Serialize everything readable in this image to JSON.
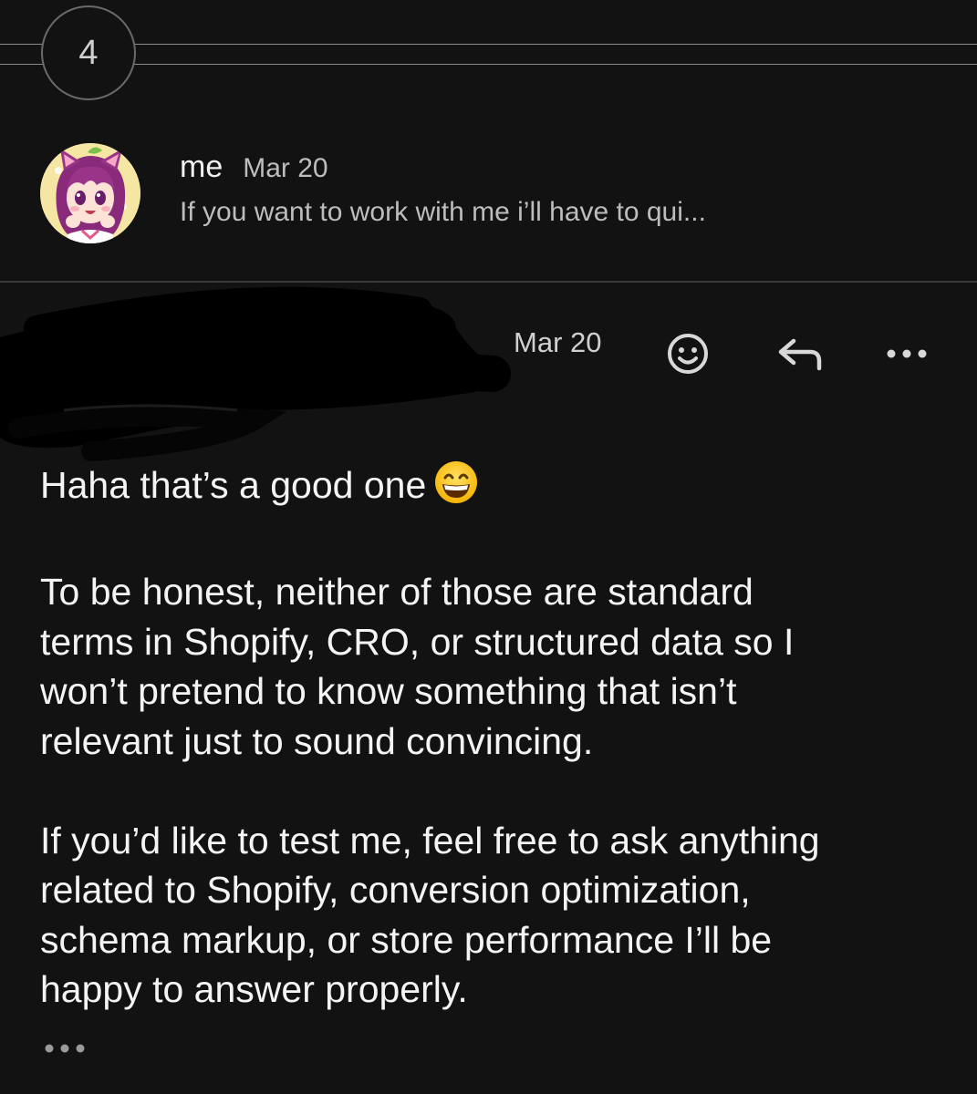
{
  "thread": {
    "collapsed_count": "4"
  },
  "collapsed_message": {
    "sender": "me",
    "date": "Mar 20",
    "snippet": "If you want to work with me i’ll have to qui..."
  },
  "expanded_message": {
    "date": "Mar 20",
    "body": {
      "line1": "Haha that’s a good one",
      "emoji": "grinning-face-emoji",
      "paragraph2": [
        "To be honest, neither of those are standard",
        "terms in Shopify, CRO, or structured data so I",
        "won’t pretend to know something that isn’t",
        "relevant just to sound convincing."
      ],
      "paragraph3": [
        "If you’d like to test me, feel free to ask anything",
        "related to Shopify, conversion optimization,",
        "schema markup, or store performance I’ll be",
        "happy to answer properly."
      ]
    },
    "actions": {
      "emoji_icon": "add-reaction-icon",
      "reply_icon": "reply-icon",
      "more_icon": "more-options-icon"
    }
  },
  "colors": {
    "background": "#121212",
    "text": "#f4f4f4",
    "muted": "#bdbdbd",
    "divider": "#3a3a3a"
  }
}
